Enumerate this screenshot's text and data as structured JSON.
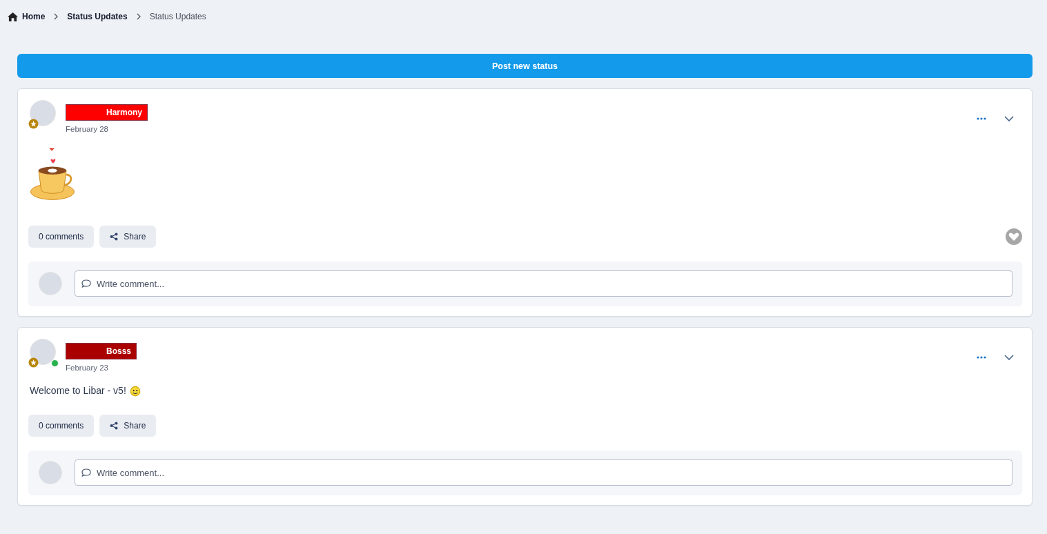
{
  "breadcrumb": [
    {
      "label": "Home",
      "kind": "home"
    },
    {
      "label": "Status Updates",
      "kind": "link"
    },
    {
      "label": "Status Updates",
      "kind": "current"
    }
  ],
  "post_button": "Post new status",
  "posts": [
    {
      "author": "Harmony",
      "color": "#ff0000",
      "date": "February 28",
      "online": false,
      "kind": "image",
      "comments": "0 comments",
      "share": "Share",
      "liked": false,
      "comment_placeholder": "Write comment..."
    },
    {
      "author": "Bosss",
      "color": "#aa0000",
      "date": "February 23",
      "online": true,
      "kind": "text",
      "text": "Welcome to Libar - v5!",
      "comments": "0 comments",
      "share": "Share",
      "comment_placeholder": "Write comment..."
    }
  ]
}
